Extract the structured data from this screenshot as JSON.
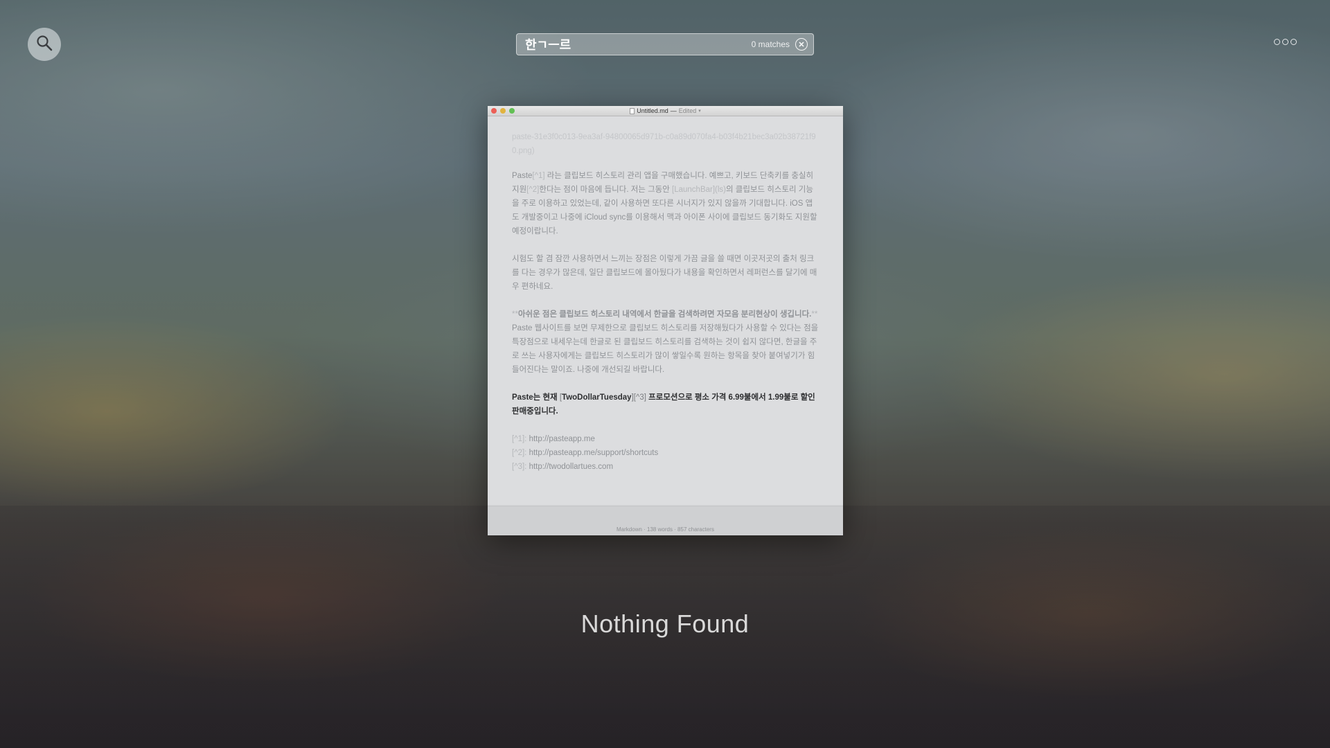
{
  "search": {
    "query": "한ㄱㅡ르",
    "match_count": "0 matches"
  },
  "icons": {
    "left": "search-icon",
    "clear": "clear-icon",
    "more": "more-icon"
  },
  "preview": {
    "title": "Untitled.md",
    "title_sep": "—",
    "edited": "Edited",
    "faded_line": "paste-31e3f0c013-9ea3af-94800065d971b-c0a89d070fa4-b03f4b21bec3a02b38721f90.png)",
    "para1": {
      "a": "Paste",
      "b": "[^1]",
      "c": " 라는 클립보드 히스토리 관리 앱을 구매했습니다. 예쁘고, 키보드 단축키를 충실히 지원",
      "d": "[^2]",
      "e": "한다는 점이 마음에 듭니다. 저는 그동안 ",
      "f": "[LaunchBar](ls)",
      "g": "의 클립보드 히스토리 기능을 주로 이용하고 있었는데, 같이 사용하면 또다른 시너지가 있지 않을까 기대합니다. iOS 앱도 개발중이고 나중에 iCloud sync를 이용해서 맥과 아이폰 사이에 클립보드 동기화도 지원할 예정이랍니다."
    },
    "para2": "시험도 할 겸 잠깐 사용하면서 느끼는 장점은 이렇게 가끔 글을 쓸 때면 이곳저곳의 출처 링크를 다는 경우가 많은데, 일단 클립보드에 몰아뒀다가 내용을 확인하면서 레퍼런스를 달기에 매우 편하네요.",
    "para3": {
      "a": "**",
      "b": "아쉬운 점은 클립보드 히스토리 내역에서 한글을 검색하려면 자모음 분리현상이 생깁니다.",
      "c": "**",
      "d": " Paste 웹사이트를 보면 무제한으로 클립보드 히스토리를 저장해뒀다가 사용할 수 있다는 점을 특장점으로 내세우는데 한글로 된 클립보드 히스토리를 검색하는 것이 쉽지 않다면, 한글을 주로 쓰는 사용자에게는 클립보드 히스토리가 많이 쌓일수록 원하는 항목을 찾아 붙여넣기가 힘들어진다는 말이죠. 나중에 개선되길 바랍니다."
    },
    "para4": {
      "a": "Paste는 현재 ",
      "b": "[",
      "c": "TwoDollarTuesday",
      "d": "][^3]",
      "e": " 프로모션으로 평소 가격 6.99불에서 1.99불로 할인 판매중입니다."
    },
    "footnotes": [
      {
        "mark": "[^1]: ",
        "url": "http://pasteapp.me"
      },
      {
        "mark": "[^2]: ",
        "url": "http://pasteapp.me/support/shortcuts"
      },
      {
        "mark": "[^3]: ",
        "url": "http://twodollartues.com"
      }
    ],
    "status": "Markdown · 138 words · 857 characters"
  },
  "empty_state": "Nothing Found"
}
